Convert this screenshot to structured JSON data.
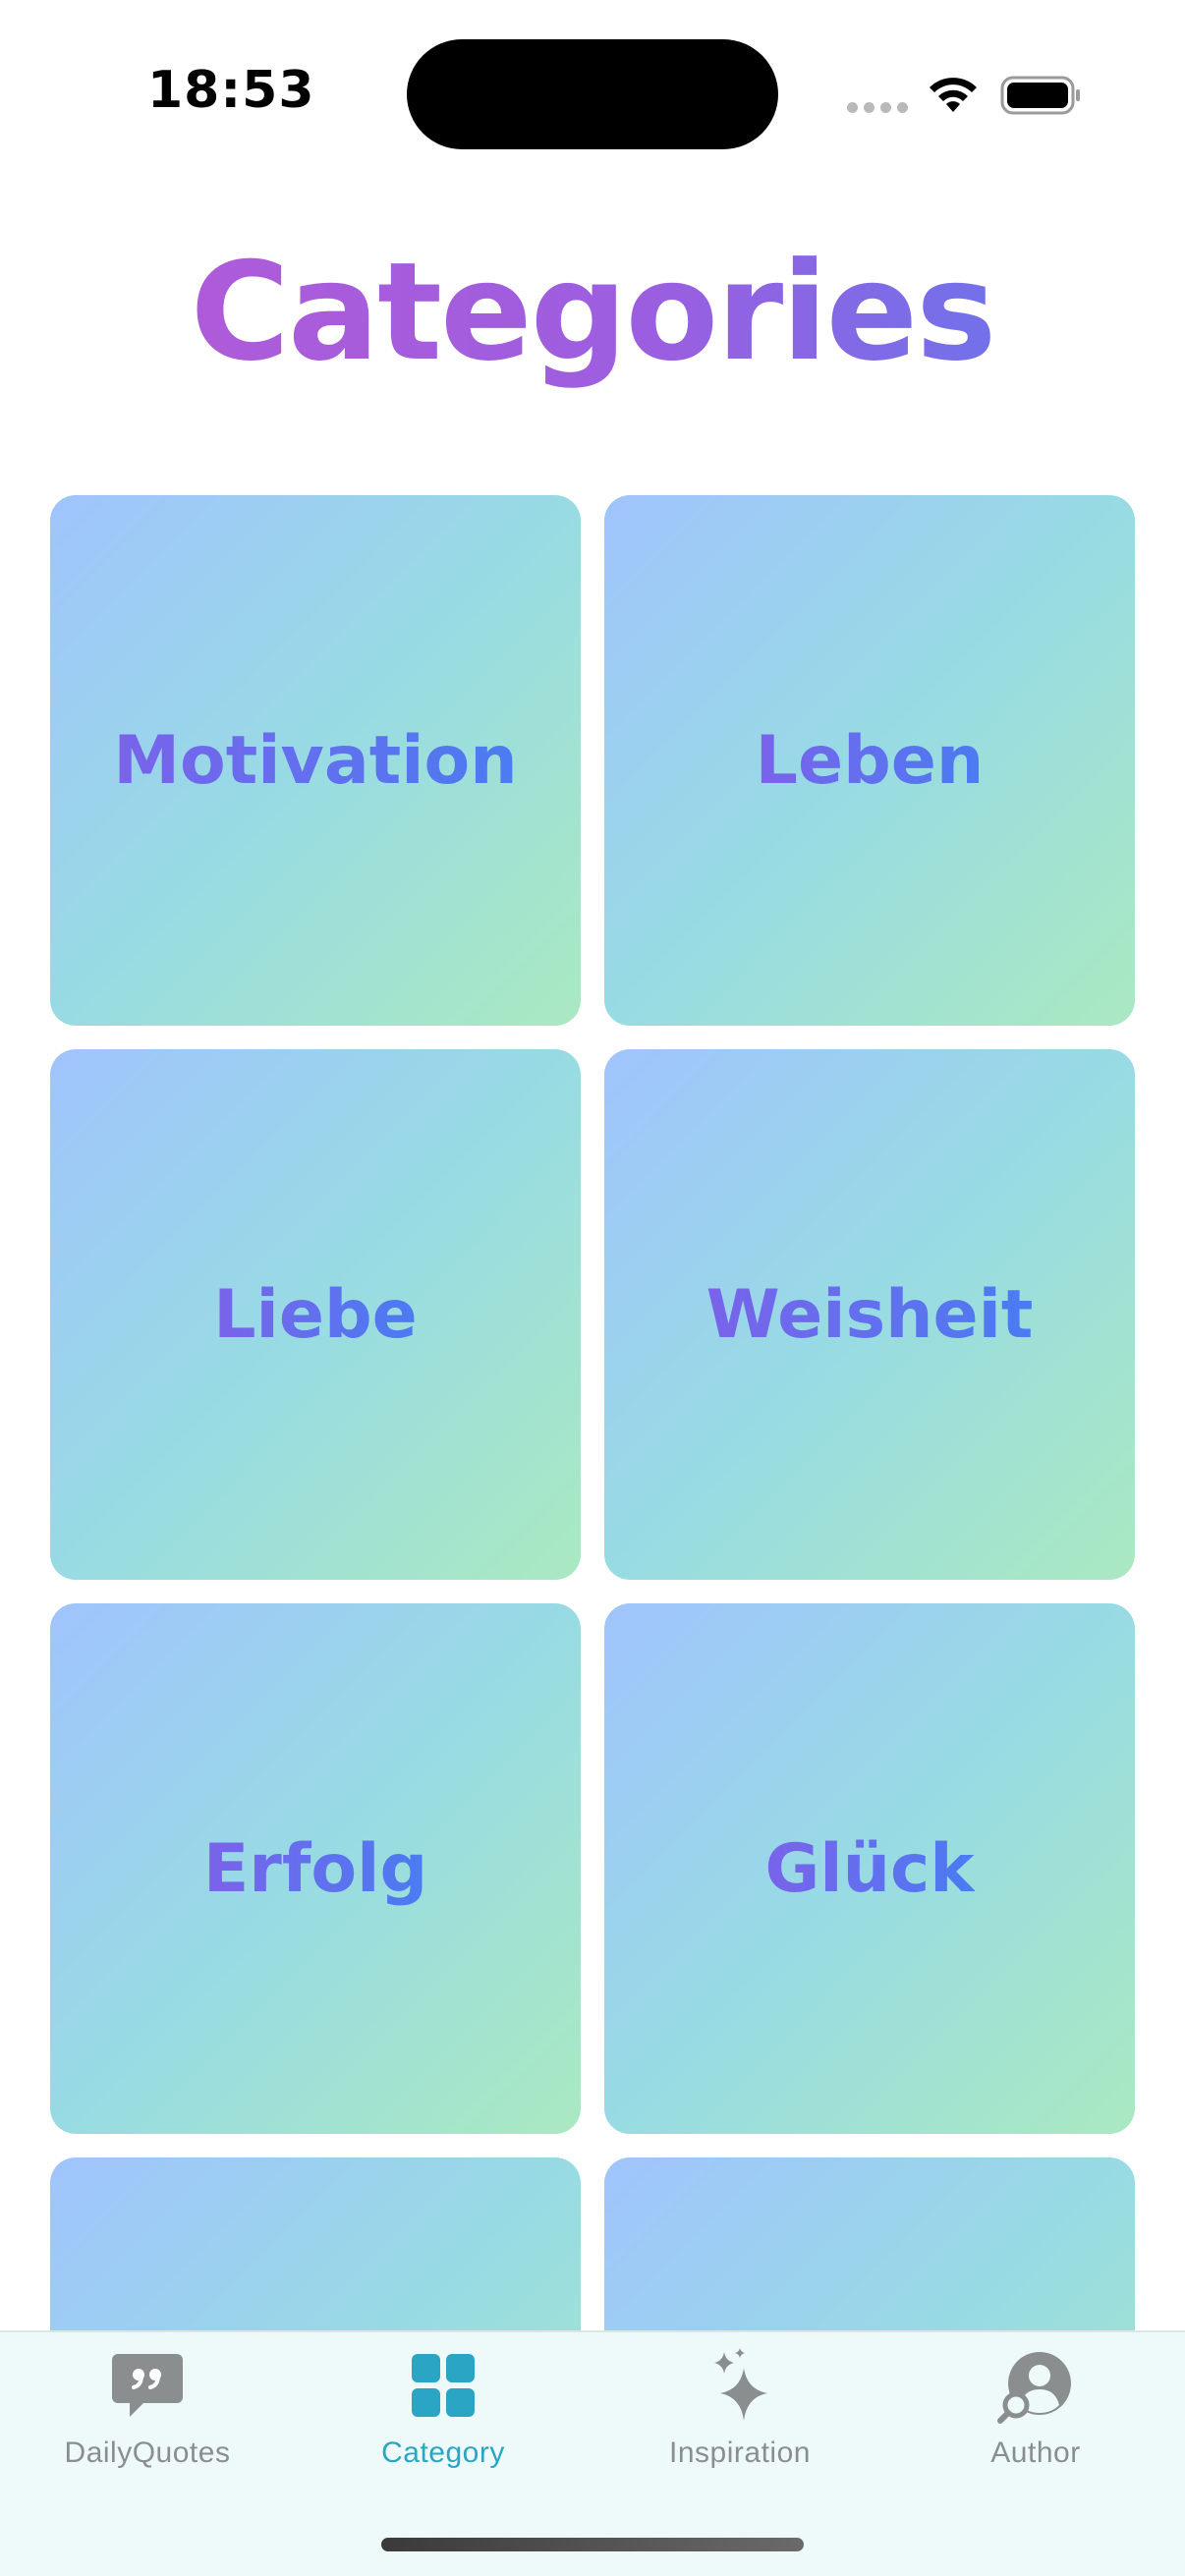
{
  "status_bar": {
    "time": "18:53"
  },
  "header": {
    "title": "Categories"
  },
  "categories": [
    {
      "label": "Motivation"
    },
    {
      "label": "Leben"
    },
    {
      "label": "Liebe"
    },
    {
      "label": "Weisheit"
    },
    {
      "label": "Erfolg"
    },
    {
      "label": "Glück"
    },
    {
      "label": ""
    },
    {
      "label": ""
    }
  ],
  "tab_bar": {
    "tabs": [
      {
        "label": "DailyQuotes",
        "icon": "quote-bubble-icon",
        "active": false
      },
      {
        "label": "Category",
        "icon": "grid-icon",
        "active": true
      },
      {
        "label": "Inspiration",
        "icon": "sparkles-icon",
        "active": false
      },
      {
        "label": "Author",
        "icon": "person-search-icon",
        "active": false
      }
    ]
  },
  "colors": {
    "accent": "#2aa6c4",
    "inactive_tab": "#8a8e8f",
    "title_gradient_start": "#b65ad6",
    "title_gradient_end": "#5a7cf0",
    "card_gradient_start": "#a0c4fd",
    "card_gradient_end": "#aae9c1"
  }
}
